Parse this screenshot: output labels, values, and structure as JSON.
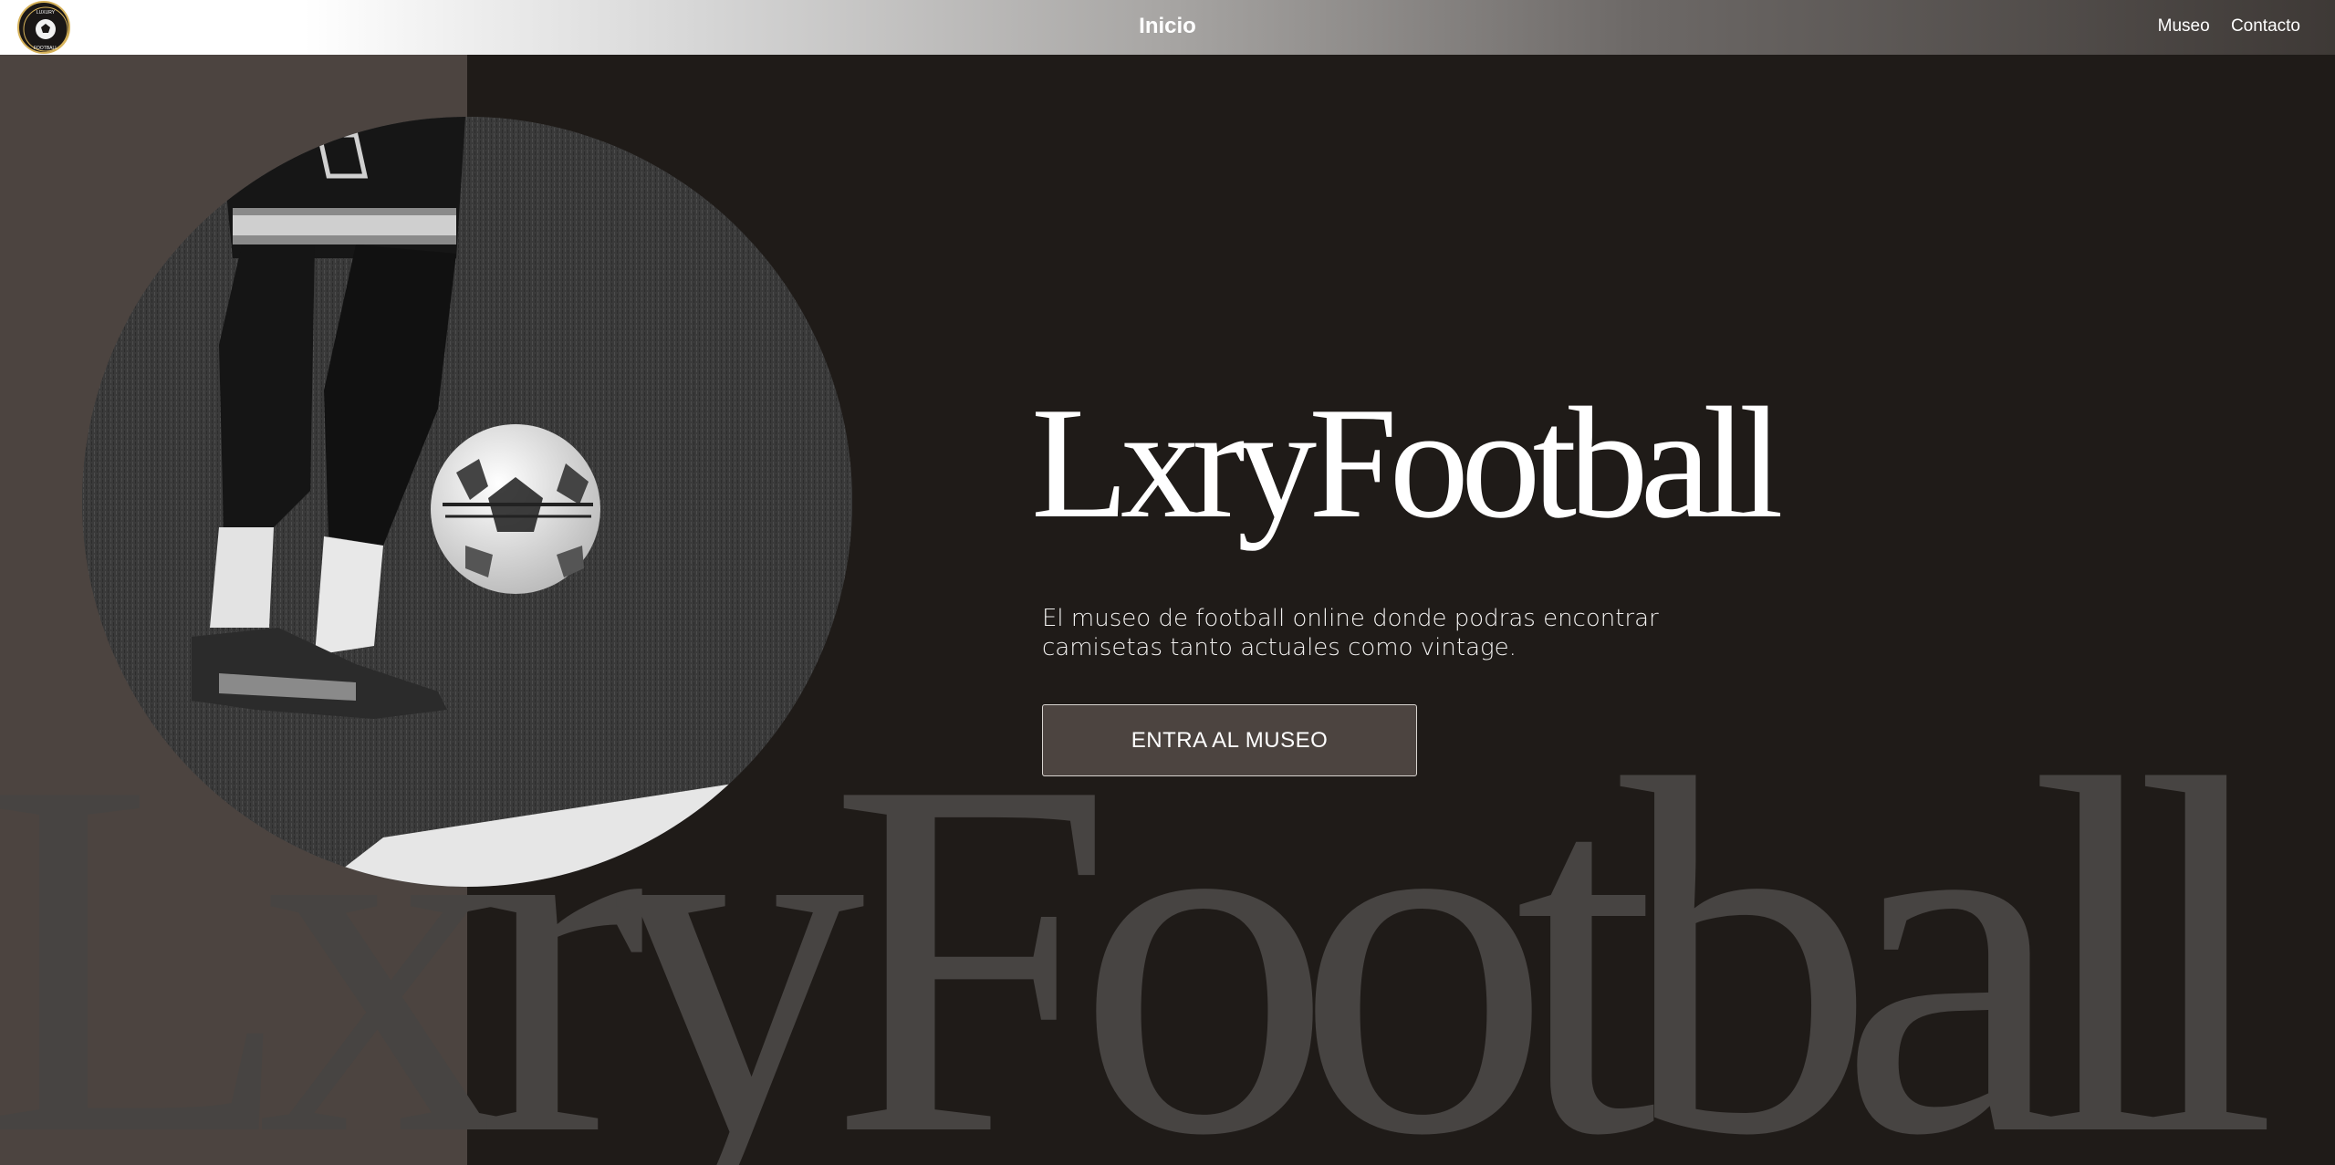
{
  "header": {
    "logo": {
      "icon": "club-crest-icon",
      "text_top": "LUXURY",
      "text_bottom": "FOOTBALL"
    },
    "center_link": "Inicio",
    "nav_links": [
      "Museo",
      "Contacto"
    ]
  },
  "hero": {
    "title": "LxryFootball",
    "subtitle": "El museo de football online donde podras encontrar camisetas tanto actuales como vintage.",
    "cta_label": "ENTRA AL MUSEO",
    "background_word": "LxryFootball",
    "image": "football-player-ball-grass-photo"
  },
  "colors": {
    "background": "#1f1b18",
    "panel": "#4c4440",
    "button": "#4c4440",
    "background_word": "#474442",
    "text": "#ffffff"
  }
}
